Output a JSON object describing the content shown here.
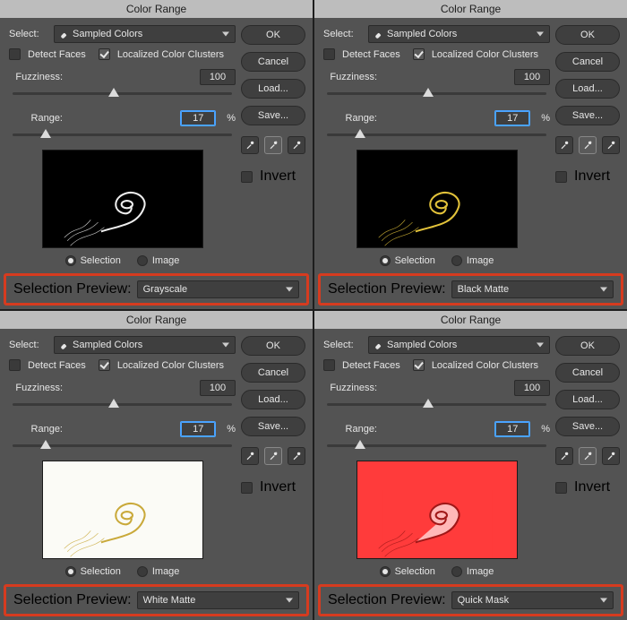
{
  "panels": [
    {
      "title": "Color Range",
      "select_label": "Select:",
      "select_value": "Sampled Colors",
      "detect_faces_label": "Detect Faces",
      "detect_faces_checked": false,
      "localized_label": "Localized Color Clusters",
      "localized_checked": true,
      "fuzziness_label": "Fuzziness:",
      "fuzziness_value": "100",
      "range_label": "Range:",
      "range_value": "17",
      "range_pct": "%",
      "radio_selection": "Selection",
      "radio_image": "Image",
      "radio_checked": "selection",
      "footer_label": "Selection Preview:",
      "footer_value": "Grayscale",
      "invert_label": "Invert",
      "invert_checked": false,
      "buttons": {
        "ok": "OK",
        "cancel": "Cancel",
        "load": "Load...",
        "save": "Save..."
      },
      "preview_style": "grayscale"
    },
    {
      "title": "Color Range",
      "select_label": "Select:",
      "select_value": "Sampled Colors",
      "detect_faces_label": "Detect Faces",
      "detect_faces_checked": false,
      "localized_label": "Localized Color Clusters",
      "localized_checked": true,
      "fuzziness_label": "Fuzziness:",
      "fuzziness_value": "100",
      "range_label": "Range:",
      "range_value": "17",
      "range_pct": "%",
      "radio_selection": "Selection",
      "radio_image": "Image",
      "radio_checked": "selection",
      "footer_label": "Selection Preview:",
      "footer_value": "Black Matte",
      "invert_label": "Invert",
      "invert_checked": false,
      "buttons": {
        "ok": "OK",
        "cancel": "Cancel",
        "load": "Load...",
        "save": "Save..."
      },
      "preview_style": "blackmatte"
    },
    {
      "title": "Color Range",
      "select_label": "Select:",
      "select_value": "Sampled Colors",
      "detect_faces_label": "Detect Faces",
      "detect_faces_checked": false,
      "localized_label": "Localized Color Clusters",
      "localized_checked": true,
      "fuzziness_label": "Fuzziness:",
      "fuzziness_value": "100",
      "range_label": "Range:",
      "range_value": "17",
      "range_pct": "%",
      "radio_selection": "Selection",
      "radio_image": "Image",
      "radio_checked": "selection",
      "footer_label": "Selection Preview:",
      "footer_value": "White Matte",
      "invert_label": "Invert",
      "invert_checked": false,
      "buttons": {
        "ok": "OK",
        "cancel": "Cancel",
        "load": "Load...",
        "save": "Save..."
      },
      "preview_style": "whitematte"
    },
    {
      "title": "Color Range",
      "select_label": "Select:",
      "select_value": "Sampled Colors",
      "detect_faces_label": "Detect Faces",
      "detect_faces_checked": false,
      "localized_label": "Localized Color Clusters",
      "localized_checked": true,
      "fuzziness_label": "Fuzziness:",
      "fuzziness_value": "100",
      "range_label": "Range:",
      "range_value": "17",
      "range_pct": "%",
      "radio_selection": "Selection",
      "radio_image": "Image",
      "radio_checked": "selection",
      "footer_label": "Selection Preview:",
      "footer_value": "Quick Mask",
      "invert_label": "Invert",
      "invert_checked": false,
      "buttons": {
        "ok": "OK",
        "cancel": "Cancel",
        "load": "Load...",
        "save": "Save..."
      },
      "preview_style": "quickmask"
    }
  ]
}
